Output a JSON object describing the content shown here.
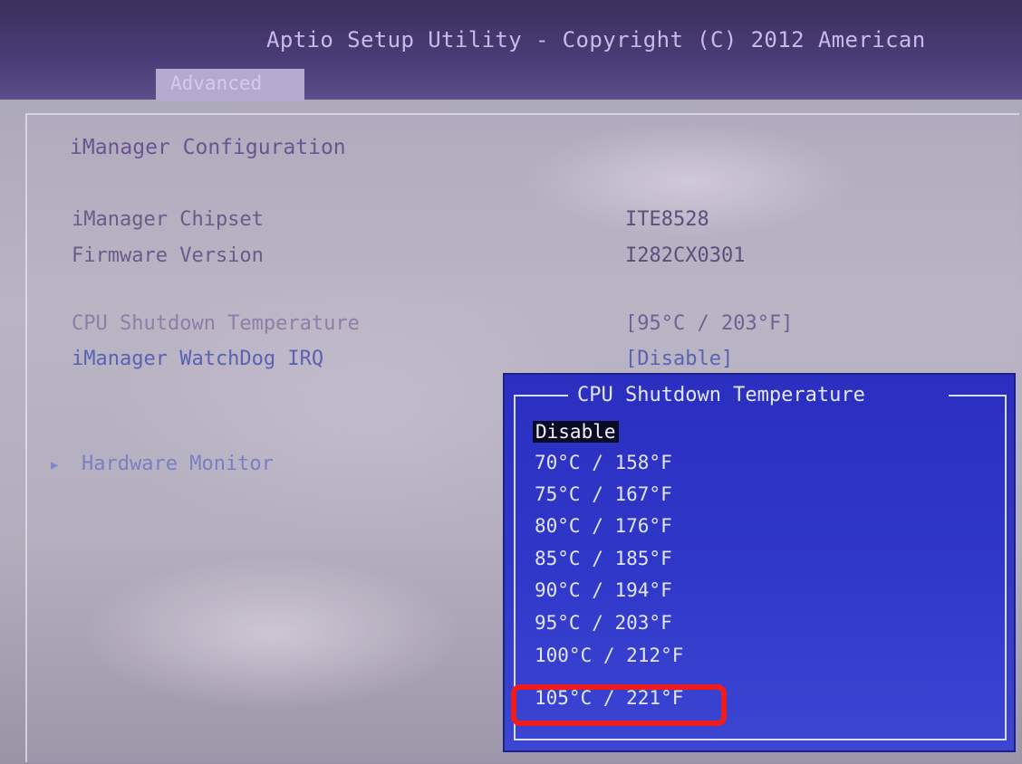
{
  "header": {
    "title": "Aptio Setup Utility - Copyright (C) 2012 American",
    "tab": "Advanced"
  },
  "main": {
    "section_title": "iManager Configuration",
    "rows": [
      {
        "label": "iManager Chipset",
        "value": "ITE8528"
      },
      {
        "label": "Firmware Version",
        "value": "I282CX0301"
      },
      {
        "label": "CPU Shutdown Temperature",
        "value": "[95°C / 203°F]"
      },
      {
        "label": "iManager WatchDog IRQ",
        "value": "[Disable]"
      }
    ],
    "submenu": "Hardware Monitor"
  },
  "popup": {
    "title": "CPU Shutdown Temperature",
    "options": [
      "Disable",
      "70°C / 158°F",
      "75°C / 167°F",
      "80°C / 176°F",
      "85°C / 185°F",
      "90°C / 194°F",
      "95°C / 203°F",
      "100°C / 212°F",
      "105°C / 221°F"
    ],
    "selected_index": 0,
    "annotated_index": 8
  },
  "colors": {
    "popup_background": "#2f37c9",
    "annotation": "#ee1c1c"
  }
}
